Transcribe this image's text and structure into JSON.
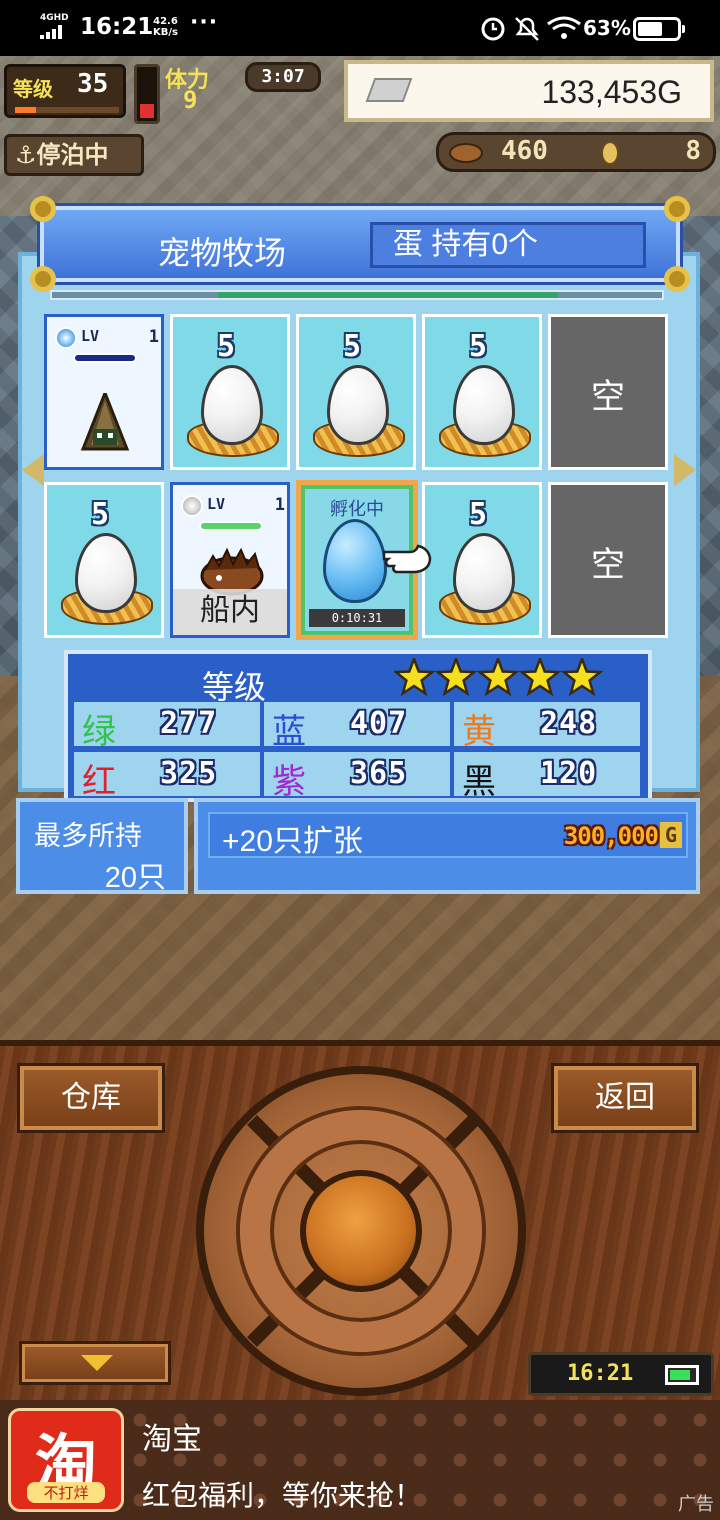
{
  "status_bar": {
    "network": "4GHD",
    "time": "16:21",
    "speed_value": "42.6",
    "speed_unit": "KB/s",
    "dots": "···",
    "battery_pct": "63%",
    "battery_level": 0.63
  },
  "hud": {
    "level_label": "等级",
    "level": "35",
    "level_progress": 0.2,
    "stamina_label": "体力",
    "stamina": "9",
    "stamina_level": 0.3,
    "timer": "3:07",
    "gold": "133,453G",
    "moored": "停泊中",
    "cargo_a": "460",
    "cargo_b": "8"
  },
  "ranch": {
    "title": "宠物牧场",
    "egg_count": "蛋 持有0个",
    "empty_label": "空",
    "slots_row1": [
      {
        "type": "pet",
        "lv_label": "LV",
        "lv": "1"
      },
      {
        "type": "egg",
        "num": "5"
      },
      {
        "type": "egg",
        "num": "5"
      },
      {
        "type": "egg",
        "num": "5"
      },
      {
        "type": "empty"
      }
    ],
    "slots_row2": [
      {
        "type": "egg",
        "num": "5"
      },
      {
        "type": "pet",
        "lv_label": "LV",
        "lv": "1",
        "tag": "船内"
      },
      {
        "type": "hatching",
        "label": "孵化中",
        "timer": "0:10:31"
      },
      {
        "type": "egg",
        "num": "5"
      },
      {
        "type": "empty"
      }
    ]
  },
  "stats": {
    "header": "等级",
    "stars": 5,
    "rows": [
      [
        {
          "name": "绿",
          "value": "277",
          "color": "#2fc44a"
        },
        {
          "name": "蓝",
          "value": "407",
          "color": "#2a4fd0"
        },
        {
          "name": "黄",
          "value": "248",
          "color": "#f07a1a"
        }
      ],
      [
        {
          "name": "红",
          "value": "325",
          "color": "#e0202a"
        },
        {
          "name": "紫",
          "value": "365",
          "color": "#a02ad0"
        },
        {
          "name": "黑",
          "value": "120",
          "color": "#111111"
        }
      ]
    ]
  },
  "capacity": {
    "label": "最多所持",
    "value": "20只",
    "expand_label": "+20只扩张",
    "expand_cost": "300,000",
    "currency": "G"
  },
  "controls": {
    "warehouse": "仓库",
    "back": "返回",
    "clock": "16:21"
  },
  "ad": {
    "logo_char": "淘",
    "logo_sub": "不打烊",
    "title": "淘宝",
    "desc": "红包福利，等你来抢！",
    "tag": "广告"
  }
}
